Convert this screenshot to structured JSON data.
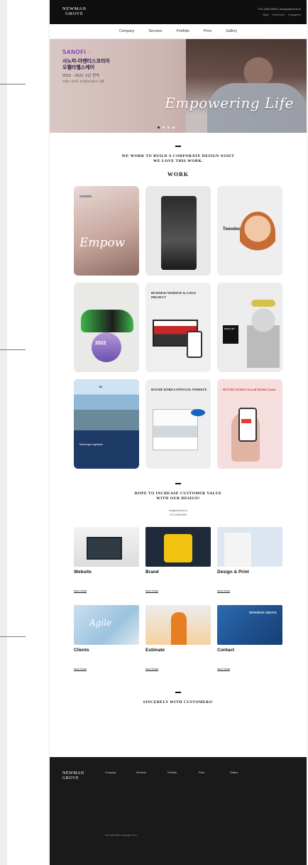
{
  "colors": {
    "topbar": "#0f0f0f",
    "footer": "#1a1a1a",
    "brand_purple": "#7b3fb5"
  },
  "header": {
    "logo_line1": "NEWMAN",
    "logo_line2": "GROVE",
    "phone": "070-4448-5560",
    "email": "design@ncms.kr",
    "links": [
      "Blog",
      "Facebook",
      "Instagram"
    ]
  },
  "nav": {
    "items": [
      "Company",
      "Services",
      "Portfolio",
      "Price",
      "Gallery"
    ]
  },
  "hero": {
    "brand": "SANOFI",
    "title_line1": "사노피-아벤티스코리아",
    "title_line2": "오펠라헬스케어",
    "period": "2016 - 2022, 6년 연속",
    "sub": "브랜드 사이트 유지관리서비스 진행",
    "slogan": "Empowering Life",
    "dots": [
      "1",
      "2",
      "3",
      "4"
    ]
  },
  "work_section": {
    "title_line1": "WE WORK TO BUILD A CORPORATE DESIGN ASSET",
    "title_line2": "WE LOVE THIS WORK.",
    "label": "WORK",
    "cards": [
      {
        "name": "sanofi",
        "text": "Empow"
      },
      {
        "name": "dark-phone",
        "text": ""
      },
      {
        "name": "tooodoc",
        "text": "Tooodoc"
      },
      {
        "name": "motorbike",
        "text": "2022"
      },
      {
        "name": "business-website",
        "text": "BUSINESS WEBSITE & LOGO PROJECT"
      },
      {
        "name": "statue",
        "text": "story art"
      },
      {
        "name": "boehringer",
        "text": "Boehringer Ingelheim"
      },
      {
        "name": "roche-website",
        "text": "ROCHE KOREA OFFICIAL WEBSITE"
      },
      {
        "name": "roche-mobile",
        "text": "ROCHE KOREA Enroll Mobile Guide"
      }
    ]
  },
  "service_section": {
    "title_line1": "HOPE TO INCREASE CUSTOMER VALUE",
    "title_line2": "WITH OUR DESIGN!",
    "email": "design@ncms.kr",
    "phone": "070-4448-5560",
    "more_label": "READ MORE",
    "items": [
      {
        "title": "Website"
      },
      {
        "title": "Brand"
      },
      {
        "title": "Design & Print"
      },
      {
        "title": "Clients",
        "image_text": "Agile"
      },
      {
        "title": "Estimate"
      },
      {
        "title": "Contact",
        "image_text": "NEWMAN GROVE"
      }
    ]
  },
  "closing_section": {
    "title": "SINCERELY WITH CUSTOMERS!"
  },
  "footer": {
    "logo_line1": "NEWMAN",
    "logo_line2": "GROVE",
    "columns": [
      "Company",
      "Services",
      "Portfolio",
      "Price",
      "Gallery"
    ],
    "contact": "070-4448-5560 | design@ncms.kr"
  }
}
